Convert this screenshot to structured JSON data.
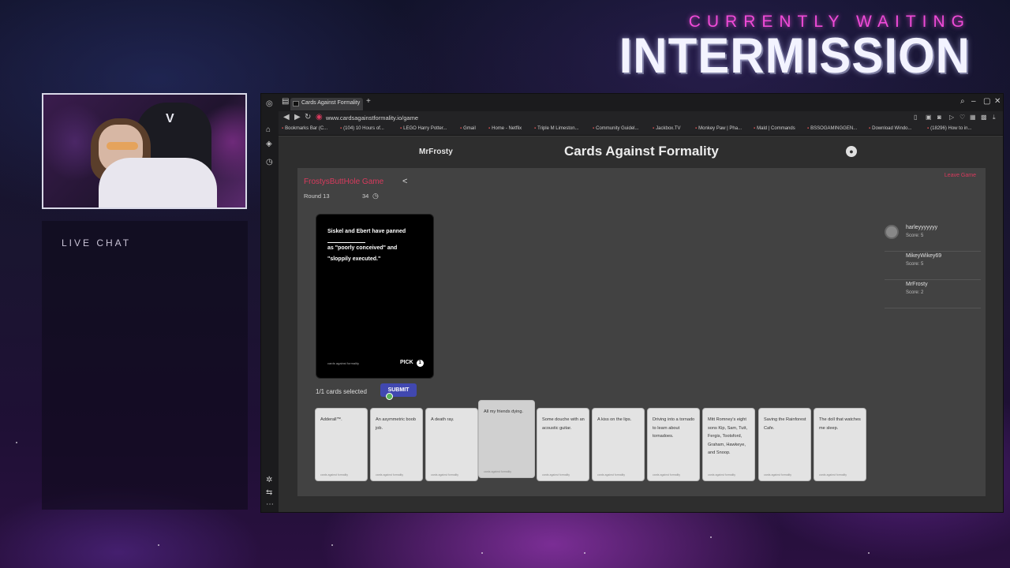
{
  "overlay": {
    "subtitle": "CURRENTLY WAITING",
    "title": "INTERMISSION",
    "chat_title": "LIVE CHAT"
  },
  "webcam": {
    "chair_logo": "V"
  },
  "browser": {
    "tab_title": "Cards Against Formality",
    "url": "www.cardsagainstformality.io/game",
    "bookmarks": [
      "Bookmarks Bar (C...",
      "(104) 10 Hours of...",
      "LEGO Harry Potter...",
      "Gmail",
      "Home - Netflix",
      "Triple M Limeston...",
      "Community Guidel...",
      "Jackbox.TV",
      "Monkey Paw | Pha...",
      "Mald | Commands",
      "BSSOGAMINGGEN...",
      "Download Windo...",
      "(18296) How to in..."
    ]
  },
  "app": {
    "username": "MrFrosty",
    "title": "Cards Against Formality",
    "game_name": "FrostysButtHole Game",
    "round_label": "Round 13",
    "timer": "34",
    "leave_label": "Leave Game",
    "black_card": {
      "line1": "Siskel and Ebert have panned",
      "line2": "as \"poorly conceived\" and",
      "line3": "\"sloppily executed.\"",
      "brand": "cards against formality",
      "pick_label": "PICK",
      "pick_count": "1"
    },
    "selected_text": "1/1 cards selected",
    "submit_label": "SUBMIT",
    "players": [
      {
        "name": "harleyyyyyyy",
        "score": "Score: 5"
      },
      {
        "name": "MikeyWikey69",
        "score": "Score: 5"
      },
      {
        "name": "MrFrosty",
        "score": "Score: 2"
      }
    ],
    "hand": [
      {
        "text": "Adderall™.",
        "brand": "cards against formality"
      },
      {
        "text": "An asymmetric boob job.",
        "brand": "cards against formality"
      },
      {
        "text": "A death ray.",
        "brand": "cards against formality"
      },
      {
        "text": "All my friends dying.",
        "brand": "cards against formality"
      },
      {
        "text": "Some douche with an acoustic guitar.",
        "brand": "cards against formality"
      },
      {
        "text": "A kiss on the lips.",
        "brand": "cards against formality"
      },
      {
        "text": "Driving into a tornado to learn about tornadoes.",
        "brand": "cards against formality"
      },
      {
        "text": "Mitt Romney's eight sons Kip, Sam, Tutt, Fergis, Tootsford, Graham, Hawkeye, and Snoop.",
        "brand": "cards against formality"
      },
      {
        "text": "Saving the Rainforest Cafe.",
        "brand": "cards against formality"
      },
      {
        "text": "The doll that watches me sleep.",
        "brand": "cards against formality"
      }
    ]
  },
  "colors": {
    "accent_pink": "#d83a5d",
    "submit_blue": "#4148b0",
    "overlay_magenta": "#f04bd8"
  }
}
